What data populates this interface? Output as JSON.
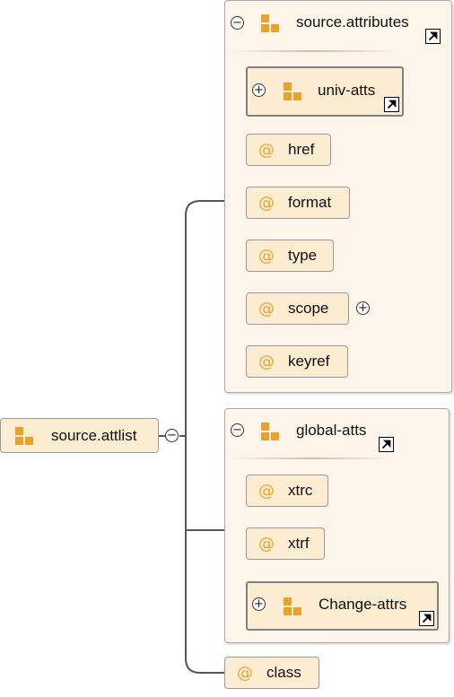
{
  "root": {
    "label": "source.attlist"
  },
  "source_attributes": {
    "label": "source.attributes",
    "children": {
      "univ_atts": "univ-atts",
      "href": "href",
      "format": "format",
      "type": "type",
      "scope": "scope",
      "keyref": "keyref"
    }
  },
  "global_atts": {
    "label": "global-atts",
    "children": {
      "xtrc": "xtrc",
      "xtrf": "xtrf",
      "change_attrs": "Change-attrs"
    }
  },
  "class_attr": {
    "label": "class"
  },
  "symbols": {
    "attribute": "@",
    "collapse": "−",
    "expand": "+"
  },
  "icons": {
    "group": "attribute-group-icon",
    "shortcut": "shortcut-arrow-icon",
    "attribute": "at-sign-icon"
  },
  "colors": {
    "group_bg": "#fdf5e9",
    "node_bg": "#fcecd2",
    "icon_orange": "#e8a32c",
    "connector": "#555555"
  }
}
